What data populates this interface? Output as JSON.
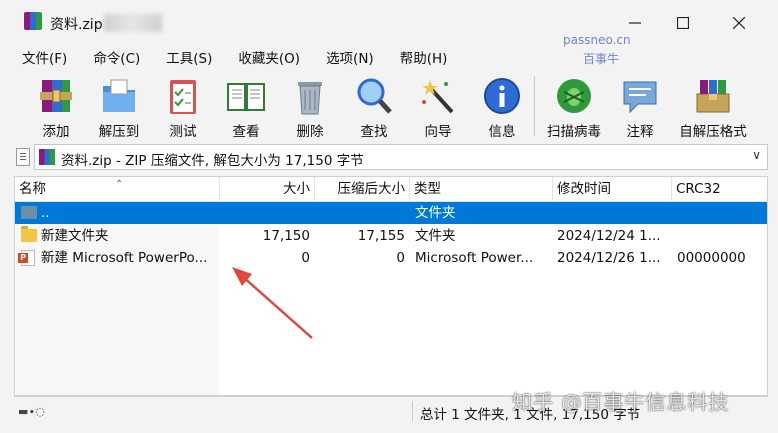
{
  "window": {
    "title": "资料.zip",
    "minimize_icon": "minimize-icon",
    "maximize_icon": "maximize-icon",
    "close_icon": "close-icon"
  },
  "watermarks": {
    "top_line1": "passneo.cn",
    "top_line2": "百事牛",
    "bottom": "知乎 @百事牛信息科技"
  },
  "menu": [
    {
      "label": "文件(F)"
    },
    {
      "label": "命令(C)"
    },
    {
      "label": "工具(S)"
    },
    {
      "label": "收藏夹(O)"
    },
    {
      "label": "选项(N)"
    },
    {
      "label": "帮助(H)"
    }
  ],
  "toolbar": [
    {
      "label": "添加",
      "icon": "add-archive-icon"
    },
    {
      "label": "解压到",
      "icon": "extract-to-icon"
    },
    {
      "label": "测试",
      "icon": "test-icon"
    },
    {
      "label": "查看",
      "icon": "view-icon"
    },
    {
      "label": "删除",
      "icon": "delete-icon"
    },
    {
      "label": "查找",
      "icon": "find-icon"
    },
    {
      "label": "向导",
      "icon": "wizard-icon"
    },
    {
      "label": "信息",
      "icon": "info-icon"
    },
    {
      "label": "扫描病毒",
      "icon": "virus-scan-icon"
    },
    {
      "label": "注释",
      "icon": "comment-icon"
    },
    {
      "label": "自解压格式",
      "icon": "sfx-icon"
    }
  ],
  "address": {
    "text": "资料.zip - ZIP 压缩文件, 解包大小为 17,150 字节"
  },
  "columns": {
    "name": "名称",
    "size": "大小",
    "packed": "压缩后大小",
    "type": "类型",
    "modified": "修改时间",
    "crc": "CRC32"
  },
  "rows": [
    {
      "name": "..",
      "size": "",
      "packed": "",
      "type": "文件夹",
      "modified": "",
      "crc": "",
      "selected": true
    },
    {
      "name": "新建文件夹",
      "size": "17,150",
      "packed": "17,155",
      "type": "文件夹",
      "modified": "2024/12/24 1...",
      "crc": ""
    },
    {
      "name": "新建 Microsoft PowerPo...",
      "size": "0",
      "packed": "0",
      "type": "Microsoft Power...",
      "modified": "2024/12/26 1...",
      "crc": "00000000"
    }
  ],
  "status": {
    "summary": "总计 1 文件夹, 1 文件, 17,150 字节"
  },
  "colors": {
    "selection": "#0078d7",
    "annotation_arrow": "#e2463c"
  }
}
